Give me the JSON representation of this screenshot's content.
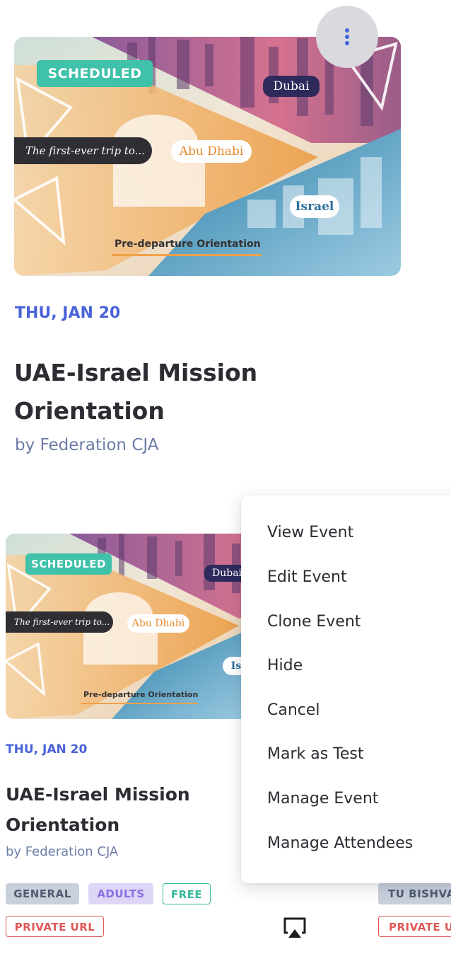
{
  "colors": {
    "accent": "#4a63d8",
    "status_scheduled": "#3fc1aa",
    "tag_free": "#37b89d",
    "tag_private": "#e05757"
  },
  "cards": [
    {
      "status": "SCHEDULED",
      "image_text": {
        "tagline": "The first-ever trip to...",
        "city1": "Abu Dhabi",
        "city2": "Dubai",
        "city3": "Israel",
        "caption": "Pre-departure Orientation"
      },
      "date": "THU, JAN 20",
      "title_line1": "UAE-Israel Mission",
      "title_line2": "Orientation",
      "organizer": "by Federation CJA"
    },
    {
      "status": "SCHEDULED",
      "image_text": {
        "tagline": "The first-ever trip to...",
        "city1": "Abu Dhabi",
        "city2": "Dubai",
        "city3": "Is",
        "caption": "Pre-departure Orientation"
      },
      "date": "THU, JAN 20",
      "title_line1": "UAE-Israel Mission",
      "title_line2": "Orientation",
      "organizer": "by Federation CJA",
      "tags": [
        "GENERAL",
        "ADULTS",
        "FREE"
      ],
      "private_tag": "PRIVATE URL"
    }
  ],
  "right_card": {
    "tag": "TU BISHVA",
    "private_tag": "PRIVATE U"
  },
  "menu_button_icon": "more-vertical-icon",
  "cast_icon": "airplay-icon",
  "menu": {
    "items": [
      "View Event",
      "Edit Event",
      "Clone Event",
      "Hide",
      "Cancel",
      "Mark as Test",
      "Manage Event",
      "Manage Attendees"
    ]
  }
}
